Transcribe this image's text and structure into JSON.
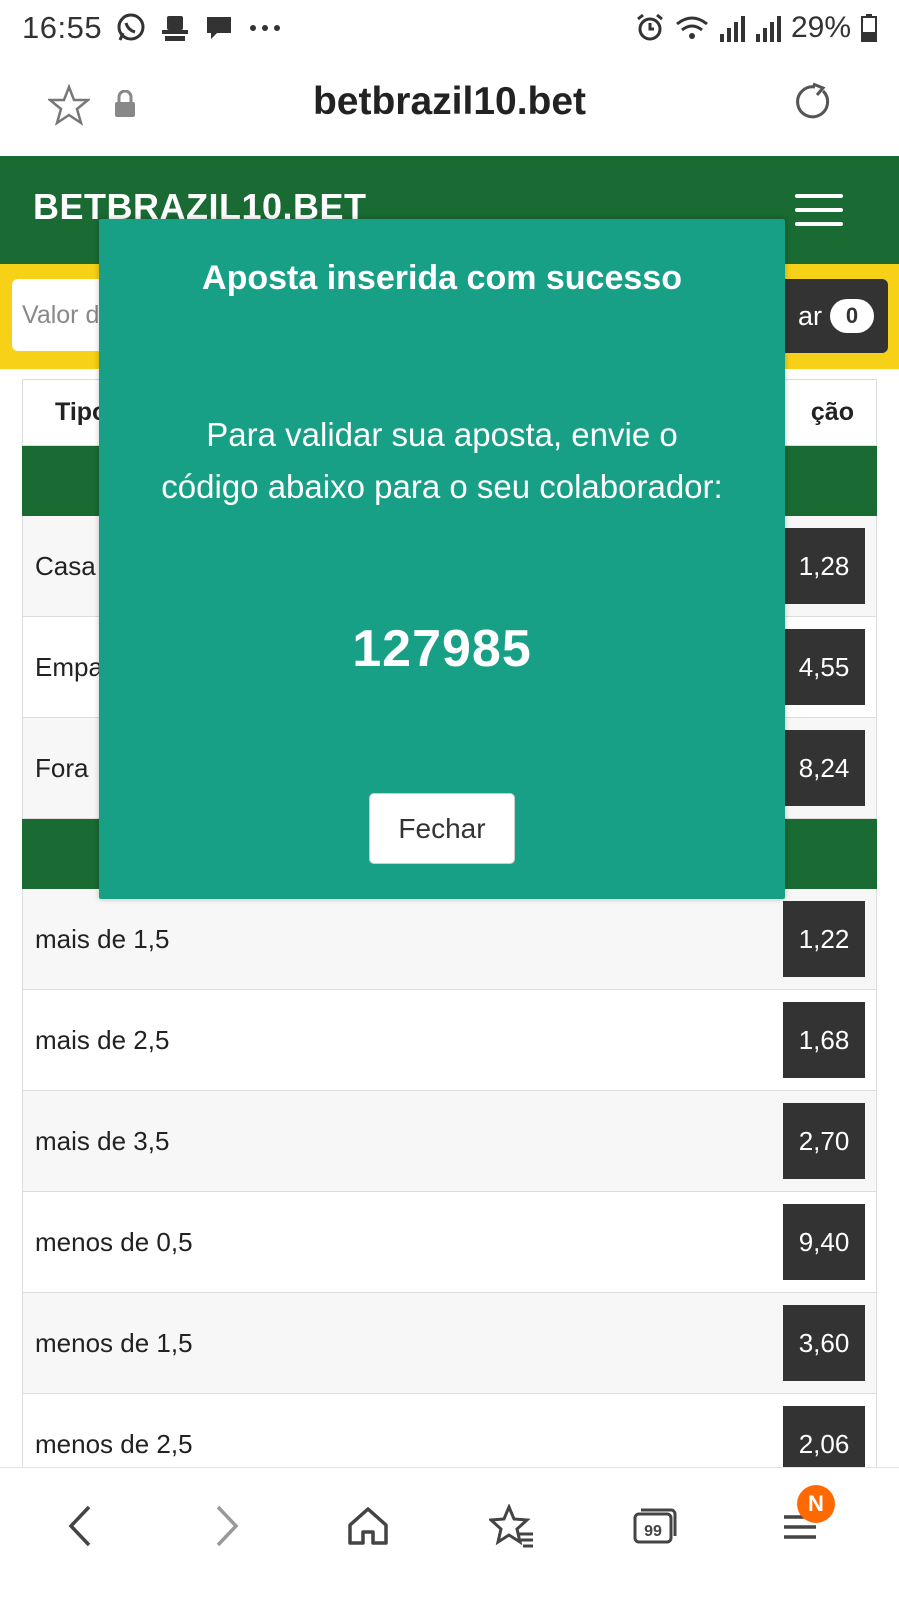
{
  "status_bar": {
    "time": "16:55",
    "battery": "29%",
    "icons": [
      "whatsapp-icon",
      "incognito-icon",
      "message-icon",
      "more-dots-icon",
      "alarm-icon",
      "wifi-icon",
      "signal-icon",
      "signal-icon-2",
      "battery-icon"
    ]
  },
  "browser": {
    "url": "betbrazil10.bet",
    "icons": [
      "star-icon",
      "lock-icon",
      "reload-icon"
    ]
  },
  "site": {
    "brand": "BETBRAZIL10.BET",
    "brand_color": "#196a33",
    "bar_color": "#f7d117"
  },
  "bet_bar": {
    "input_placeholder": "Valor d",
    "button_label": "ar",
    "count": "0"
  },
  "table": {
    "header_left": "Tipo",
    "header_right": "ção",
    "rows_group1": [
      {
        "label": "Casa",
        "odd": "1,28"
      },
      {
        "label": "Empa",
        "odd": "4,55"
      },
      {
        "label": "Fora",
        "odd": "8,24"
      }
    ],
    "rows_group2": [
      {
        "label": "mais de 1,5",
        "odd": "1,22"
      },
      {
        "label": "mais de 2,5",
        "odd": "1,68"
      },
      {
        "label": "mais de 3,5",
        "odd": "2,70"
      },
      {
        "label": "menos de 0,5",
        "odd": "9,40"
      },
      {
        "label": "menos de 1,5",
        "odd": "3,60"
      },
      {
        "label": "menos de 2,5",
        "odd": "2,06"
      }
    ]
  },
  "modal": {
    "title": "Aposta inserida com sucesso",
    "message": "Para validar sua aposta, envie o código abaixo para o seu colaborador:",
    "code": "127985",
    "close_label": "Fechar",
    "bg_color": "#18a086"
  },
  "bottom_nav": {
    "items": [
      "back-icon",
      "forward-icon",
      "home-icon",
      "bookmarks-icon",
      "tabs-icon",
      "menu-icon"
    ],
    "tabs_count": "99",
    "menu_badge": "N",
    "badge_color": "#ff6a00"
  }
}
